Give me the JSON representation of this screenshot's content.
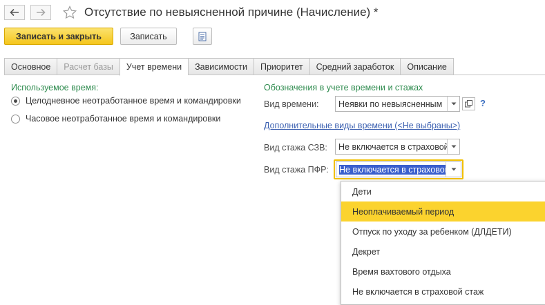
{
  "window": {
    "title": "Отсутствие по невыясненной причине (Начисление) *"
  },
  "toolbar": {
    "save_close_label": "Записать и закрыть",
    "save_label": "Записать"
  },
  "tabs": [
    {
      "label": "Основное",
      "state": "normal"
    },
    {
      "label": "Расчет базы",
      "state": "disabled"
    },
    {
      "label": "Учет времени",
      "state": "active"
    },
    {
      "label": "Зависимости",
      "state": "normal"
    },
    {
      "label": "Приоритет",
      "state": "normal"
    },
    {
      "label": "Средний заработок",
      "state": "normal"
    },
    {
      "label": "Описание",
      "state": "normal"
    }
  ],
  "time_used": {
    "title": "Используемое время:",
    "options": [
      {
        "label": "Целодневное неотработанное время и командировки",
        "selected": true
      },
      {
        "label": "Часовое неотработанное время и командировки",
        "selected": false
      }
    ]
  },
  "designations": {
    "title": "Обозначения в учете времени и стажах",
    "time_type_label": "Вид времени:",
    "time_type_value": "Неявки по невыясненным",
    "help": "?",
    "extra_link": "Дополнительные виды времени (<Не выбраны>)",
    "szv_label": "Вид стажа СЗВ:",
    "szv_value": "Не включается в страховой",
    "pfr_label": "Вид стажа ПФР:",
    "pfr_value": "Не включается в страховой"
  },
  "dropdown": {
    "items": [
      {
        "label": "Дети",
        "highlighted": false
      },
      {
        "label": "Неоплачиваемый период",
        "highlighted": true
      },
      {
        "label": "Отпуск по уходу за ребенком (ДЛДЕТИ)",
        "highlighted": false
      },
      {
        "label": "Декрет",
        "highlighted": false
      },
      {
        "label": "Время вахтового отдыха",
        "highlighted": false
      },
      {
        "label": "Не включается в страховой стаж",
        "highlighted": false
      }
    ]
  },
  "colors": {
    "accent_yellow": "#f5c61c",
    "highlight_yellow": "#fbd32e",
    "group_title_green": "#2e8b4e",
    "link_blue": "#3a5fb0",
    "selection_blue": "#3a5fcd"
  }
}
